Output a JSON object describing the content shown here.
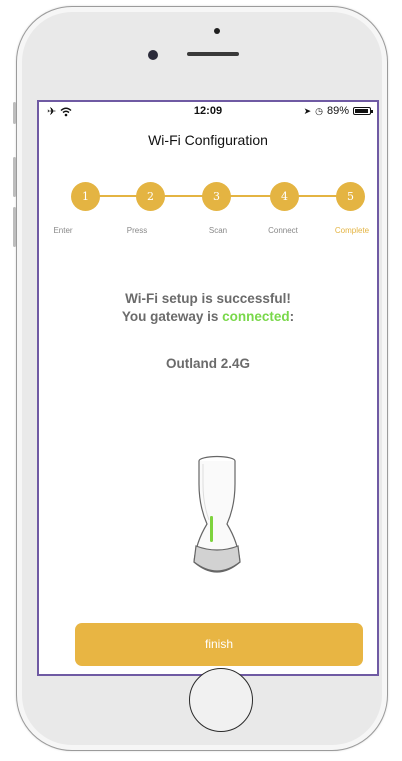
{
  "status_bar": {
    "time": "12:09",
    "battery": "89%",
    "left_icons": [
      "airplane-icon",
      "wifi-icon"
    ],
    "right_icons": [
      "location-icon",
      "alarm-icon",
      "battery-icon"
    ]
  },
  "header": {
    "title": "Wi-Fi Configuration"
  },
  "stepper": {
    "accent": "#e4b442",
    "steps": [
      {
        "number": "1",
        "label": "Enter"
      },
      {
        "number": "2",
        "label": "Press"
      },
      {
        "number": "3",
        "label": "Scan"
      },
      {
        "number": "4",
        "label": "Connect"
      },
      {
        "number": "5",
        "label": "Complete",
        "active": true
      }
    ]
  },
  "message": {
    "line1": "Wi-Fi setup is successful!",
    "line2_prefix": "You gateway is ",
    "line2_status": "connected",
    "line2_suffix": ":",
    "status_color": "#79d84a"
  },
  "network": {
    "ssid": "Outland 2.4G"
  },
  "actions": {
    "finish_label": "finish",
    "finish_color": "#e8b543"
  }
}
